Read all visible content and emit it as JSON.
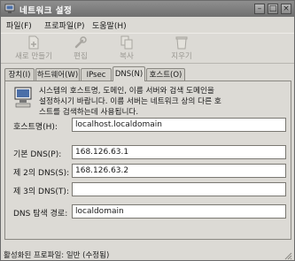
{
  "window": {
    "title": "네트워크 설정",
    "minimize": "–",
    "maximize": "□",
    "close": "×"
  },
  "menubar": [
    "파일(F)",
    "프로파일(P)",
    "도움말(H)"
  ],
  "toolbar": {
    "new": "새로 만들기",
    "edit": "편집",
    "copy": "복사",
    "delete": "지우기"
  },
  "tabs": [
    "장치(I)",
    "하드웨어(W)",
    "IPsec",
    "DNS(N)",
    "호스트(O)"
  ],
  "active_tab": "DNS(N)",
  "info_lines": [
    "시스템의 호스트명, 도메인, 이름 서버와 검색 도메인을",
    "설정하시기 바랍니다. 이름 서버는 네트워크 상의 다른 호",
    "스트를 검색하는데 사용됩니다."
  ],
  "fields": {
    "hostname": {
      "label": "호스트명(H):",
      "value": "localhost.localdomain"
    },
    "dns1": {
      "label": "기본 DNS(P):",
      "value": "168.126.63.1"
    },
    "dns2": {
      "label": "제 2의 DNS(S):",
      "value": "168.126.63.2"
    },
    "dns3": {
      "label": "제 3의 DNS(T):",
      "value": ""
    },
    "search": {
      "label": "DNS 탐색 경로:",
      "value": "localdomain"
    }
  },
  "status": "활성화된 프로파일: 일반 (수정됨)"
}
